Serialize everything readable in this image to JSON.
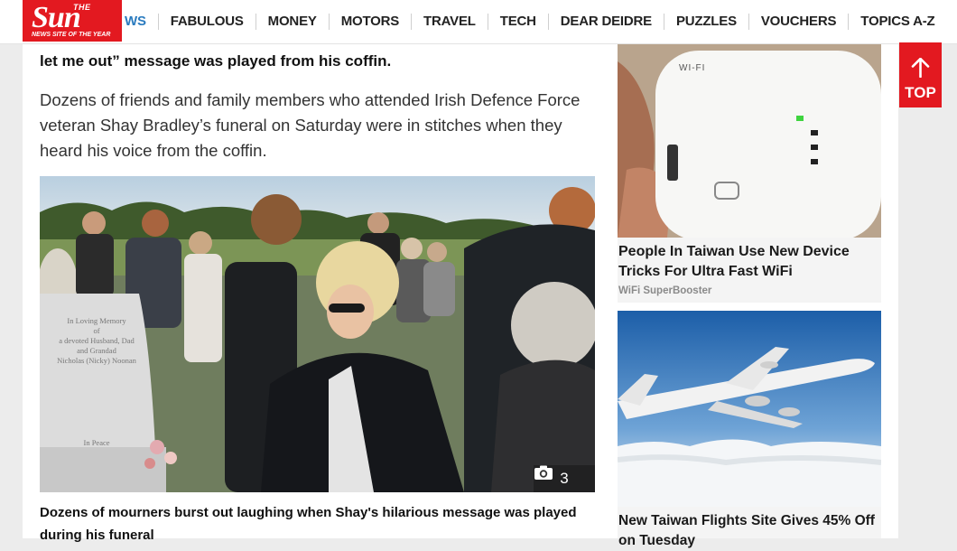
{
  "header": {
    "logo_the": "THE",
    "logo_wordmark": "Sun",
    "logo_tagline": "NEWS SITE OF THE YEAR",
    "nav": [
      "WS",
      "FABULOUS",
      "MONEY",
      "MOTORS",
      "TRAVEL",
      "TECH",
      "DEAR DEIDRE",
      "PUZZLES",
      "VOUCHERS",
      "TOPICS A-Z"
    ]
  },
  "article": {
    "lead_bold": "let me out” message was played from his coffin.",
    "paragraph": "Dozens of friends and family members who attended Irish Defence Force veteran Shay Bradley’s funeral on Saturday were in stitches when they heard his voice from the coffin.",
    "photo_count": "3",
    "caption": "Dozens of mourners burst out laughing when Shay's hilarious message was played during his funeral",
    "headstone_lines": [
      "In Loving Memory",
      "of",
      "a devoted Husband, Dad",
      "and Grandad",
      "Nicholas (Nicky) Noonan",
      "In Peace"
    ]
  },
  "sidebar": {
    "ads": [
      {
        "title": "People In Taiwan Use New Device Tricks For Ultra Fast WiFi",
        "source": "WiFi SuperBooster",
        "image_text": "WI-FI"
      },
      {
        "title": "New Taiwan Flights Site Gives 45% Off on Tuesday",
        "source": ""
      }
    ],
    "top_button": "TOP"
  },
  "colors": {
    "brand_red": "#e31920",
    "nav_blue": "#2a7bbf"
  }
}
